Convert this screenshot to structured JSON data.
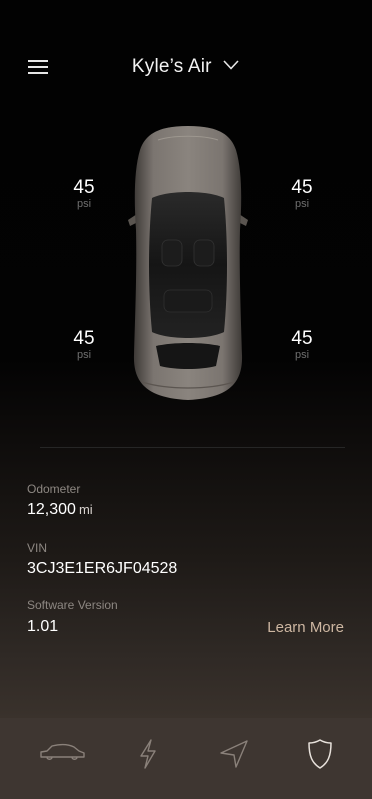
{
  "header": {
    "vehicle_name": "Kyle’s Air",
    "menu_icon": "hamburger-menu-icon",
    "dropdown_icon": "chevron-down-icon"
  },
  "tires": {
    "front_left": {
      "pressure": "45",
      "unit": "psi"
    },
    "front_right": {
      "pressure": "45",
      "unit": "psi"
    },
    "rear_left": {
      "pressure": "45",
      "unit": "psi"
    },
    "rear_right": {
      "pressure": "45",
      "unit": "psi"
    }
  },
  "vehicle_image": "car-top-view",
  "info": {
    "odometer_label": "Odometer",
    "odometer_value": "12,300",
    "odometer_unit": "mi",
    "vin_label": "VIN",
    "vin_value": "3CJ3E1ER6JF04528",
    "software_label": "Software Version",
    "software_value": "1.01",
    "learn_more": "Learn More"
  },
  "tabs": [
    {
      "icon": "car-icon",
      "active": false
    },
    {
      "icon": "lightning-icon",
      "active": false
    },
    {
      "icon": "navigation-arrow-icon",
      "active": false
    },
    {
      "icon": "shield-icon",
      "active": true
    }
  ],
  "colors": {
    "accent": "#cdb6a1",
    "tab_bar": "#3e3631",
    "label_gray": "#8d8782",
    "car_body": "#6e6862"
  }
}
